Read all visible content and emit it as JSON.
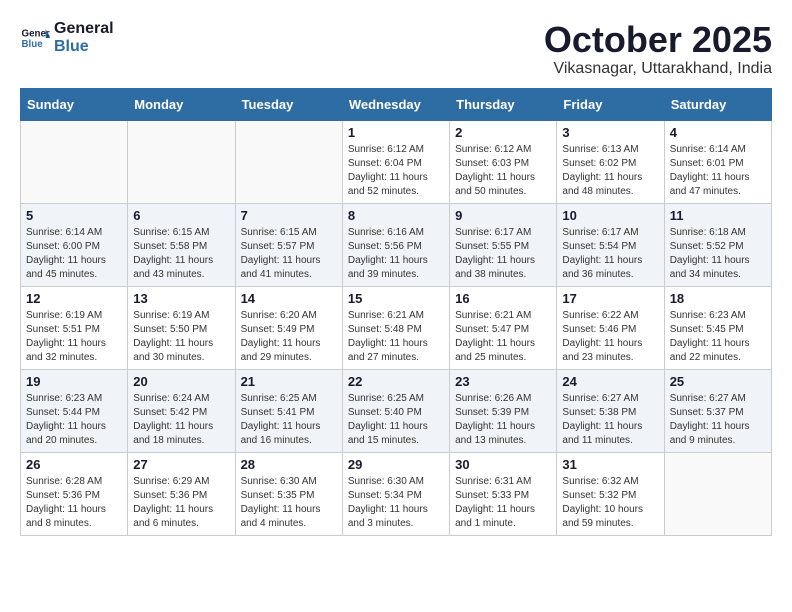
{
  "header": {
    "logo_line1": "General",
    "logo_line2": "Blue",
    "month_title": "October 2025",
    "location": "Vikasnagar, Uttarakhand, India"
  },
  "weekdays": [
    "Sunday",
    "Monday",
    "Tuesday",
    "Wednesday",
    "Thursday",
    "Friday",
    "Saturday"
  ],
  "weeks": [
    [
      {
        "day": "",
        "info": ""
      },
      {
        "day": "",
        "info": ""
      },
      {
        "day": "",
        "info": ""
      },
      {
        "day": "1",
        "info": "Sunrise: 6:12 AM\nSunset: 6:04 PM\nDaylight: 11 hours\nand 52 minutes."
      },
      {
        "day": "2",
        "info": "Sunrise: 6:12 AM\nSunset: 6:03 PM\nDaylight: 11 hours\nand 50 minutes."
      },
      {
        "day": "3",
        "info": "Sunrise: 6:13 AM\nSunset: 6:02 PM\nDaylight: 11 hours\nand 48 minutes."
      },
      {
        "day": "4",
        "info": "Sunrise: 6:14 AM\nSunset: 6:01 PM\nDaylight: 11 hours\nand 47 minutes."
      }
    ],
    [
      {
        "day": "5",
        "info": "Sunrise: 6:14 AM\nSunset: 6:00 PM\nDaylight: 11 hours\nand 45 minutes."
      },
      {
        "day": "6",
        "info": "Sunrise: 6:15 AM\nSunset: 5:58 PM\nDaylight: 11 hours\nand 43 minutes."
      },
      {
        "day": "7",
        "info": "Sunrise: 6:15 AM\nSunset: 5:57 PM\nDaylight: 11 hours\nand 41 minutes."
      },
      {
        "day": "8",
        "info": "Sunrise: 6:16 AM\nSunset: 5:56 PM\nDaylight: 11 hours\nand 39 minutes."
      },
      {
        "day": "9",
        "info": "Sunrise: 6:17 AM\nSunset: 5:55 PM\nDaylight: 11 hours\nand 38 minutes."
      },
      {
        "day": "10",
        "info": "Sunrise: 6:17 AM\nSunset: 5:54 PM\nDaylight: 11 hours\nand 36 minutes."
      },
      {
        "day": "11",
        "info": "Sunrise: 6:18 AM\nSunset: 5:52 PM\nDaylight: 11 hours\nand 34 minutes."
      }
    ],
    [
      {
        "day": "12",
        "info": "Sunrise: 6:19 AM\nSunset: 5:51 PM\nDaylight: 11 hours\nand 32 minutes."
      },
      {
        "day": "13",
        "info": "Sunrise: 6:19 AM\nSunset: 5:50 PM\nDaylight: 11 hours\nand 30 minutes."
      },
      {
        "day": "14",
        "info": "Sunrise: 6:20 AM\nSunset: 5:49 PM\nDaylight: 11 hours\nand 29 minutes."
      },
      {
        "day": "15",
        "info": "Sunrise: 6:21 AM\nSunset: 5:48 PM\nDaylight: 11 hours\nand 27 minutes."
      },
      {
        "day": "16",
        "info": "Sunrise: 6:21 AM\nSunset: 5:47 PM\nDaylight: 11 hours\nand 25 minutes."
      },
      {
        "day": "17",
        "info": "Sunrise: 6:22 AM\nSunset: 5:46 PM\nDaylight: 11 hours\nand 23 minutes."
      },
      {
        "day": "18",
        "info": "Sunrise: 6:23 AM\nSunset: 5:45 PM\nDaylight: 11 hours\nand 22 minutes."
      }
    ],
    [
      {
        "day": "19",
        "info": "Sunrise: 6:23 AM\nSunset: 5:44 PM\nDaylight: 11 hours\nand 20 minutes."
      },
      {
        "day": "20",
        "info": "Sunrise: 6:24 AM\nSunset: 5:42 PM\nDaylight: 11 hours\nand 18 minutes."
      },
      {
        "day": "21",
        "info": "Sunrise: 6:25 AM\nSunset: 5:41 PM\nDaylight: 11 hours\nand 16 minutes."
      },
      {
        "day": "22",
        "info": "Sunrise: 6:25 AM\nSunset: 5:40 PM\nDaylight: 11 hours\nand 15 minutes."
      },
      {
        "day": "23",
        "info": "Sunrise: 6:26 AM\nSunset: 5:39 PM\nDaylight: 11 hours\nand 13 minutes."
      },
      {
        "day": "24",
        "info": "Sunrise: 6:27 AM\nSunset: 5:38 PM\nDaylight: 11 hours\nand 11 minutes."
      },
      {
        "day": "25",
        "info": "Sunrise: 6:27 AM\nSunset: 5:37 PM\nDaylight: 11 hours\nand 9 minutes."
      }
    ],
    [
      {
        "day": "26",
        "info": "Sunrise: 6:28 AM\nSunset: 5:36 PM\nDaylight: 11 hours\nand 8 minutes."
      },
      {
        "day": "27",
        "info": "Sunrise: 6:29 AM\nSunset: 5:36 PM\nDaylight: 11 hours\nand 6 minutes."
      },
      {
        "day": "28",
        "info": "Sunrise: 6:30 AM\nSunset: 5:35 PM\nDaylight: 11 hours\nand 4 minutes."
      },
      {
        "day": "29",
        "info": "Sunrise: 6:30 AM\nSunset: 5:34 PM\nDaylight: 11 hours\nand 3 minutes."
      },
      {
        "day": "30",
        "info": "Sunrise: 6:31 AM\nSunset: 5:33 PM\nDaylight: 11 hours\nand 1 minute."
      },
      {
        "day": "31",
        "info": "Sunrise: 6:32 AM\nSunset: 5:32 PM\nDaylight: 10 hours\nand 59 minutes."
      },
      {
        "day": "",
        "info": ""
      }
    ]
  ]
}
